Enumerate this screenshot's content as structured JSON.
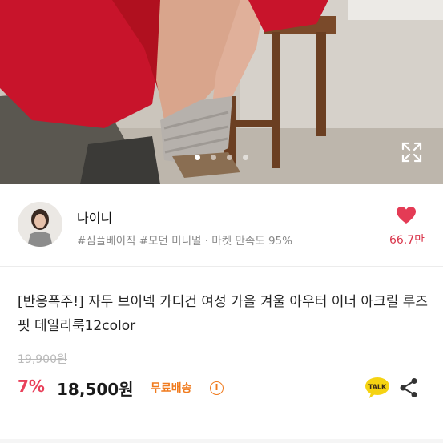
{
  "hero": {
    "slide_count": 4,
    "active_slide_index": 0
  },
  "seller": {
    "name": "나이니",
    "tags": "#심플베이직 #모던 미니멀 · 마켓 만족도 95%",
    "like_count": "66.7만",
    "liked": true
  },
  "product": {
    "title": "[반응폭주!] 자두 브이넥 가디건 여성 가을 겨울 아우터 이너 아크릴 루즈핏 데일리룩12color",
    "original_price": "19,900원",
    "discount": "7%",
    "price": "18,500원",
    "shipping_label": "무료배송",
    "info_glyph": "i",
    "talk_label": "TALK"
  },
  "colors": {
    "accent_red": "#e9405a",
    "heart_red": "#e43b55",
    "shipping_orange": "#f07b1e",
    "talk_yellow": "#f5d312"
  },
  "icons": [
    "expand-icon",
    "heart-icon",
    "talk-icon",
    "share-icon",
    "info-icon"
  ]
}
